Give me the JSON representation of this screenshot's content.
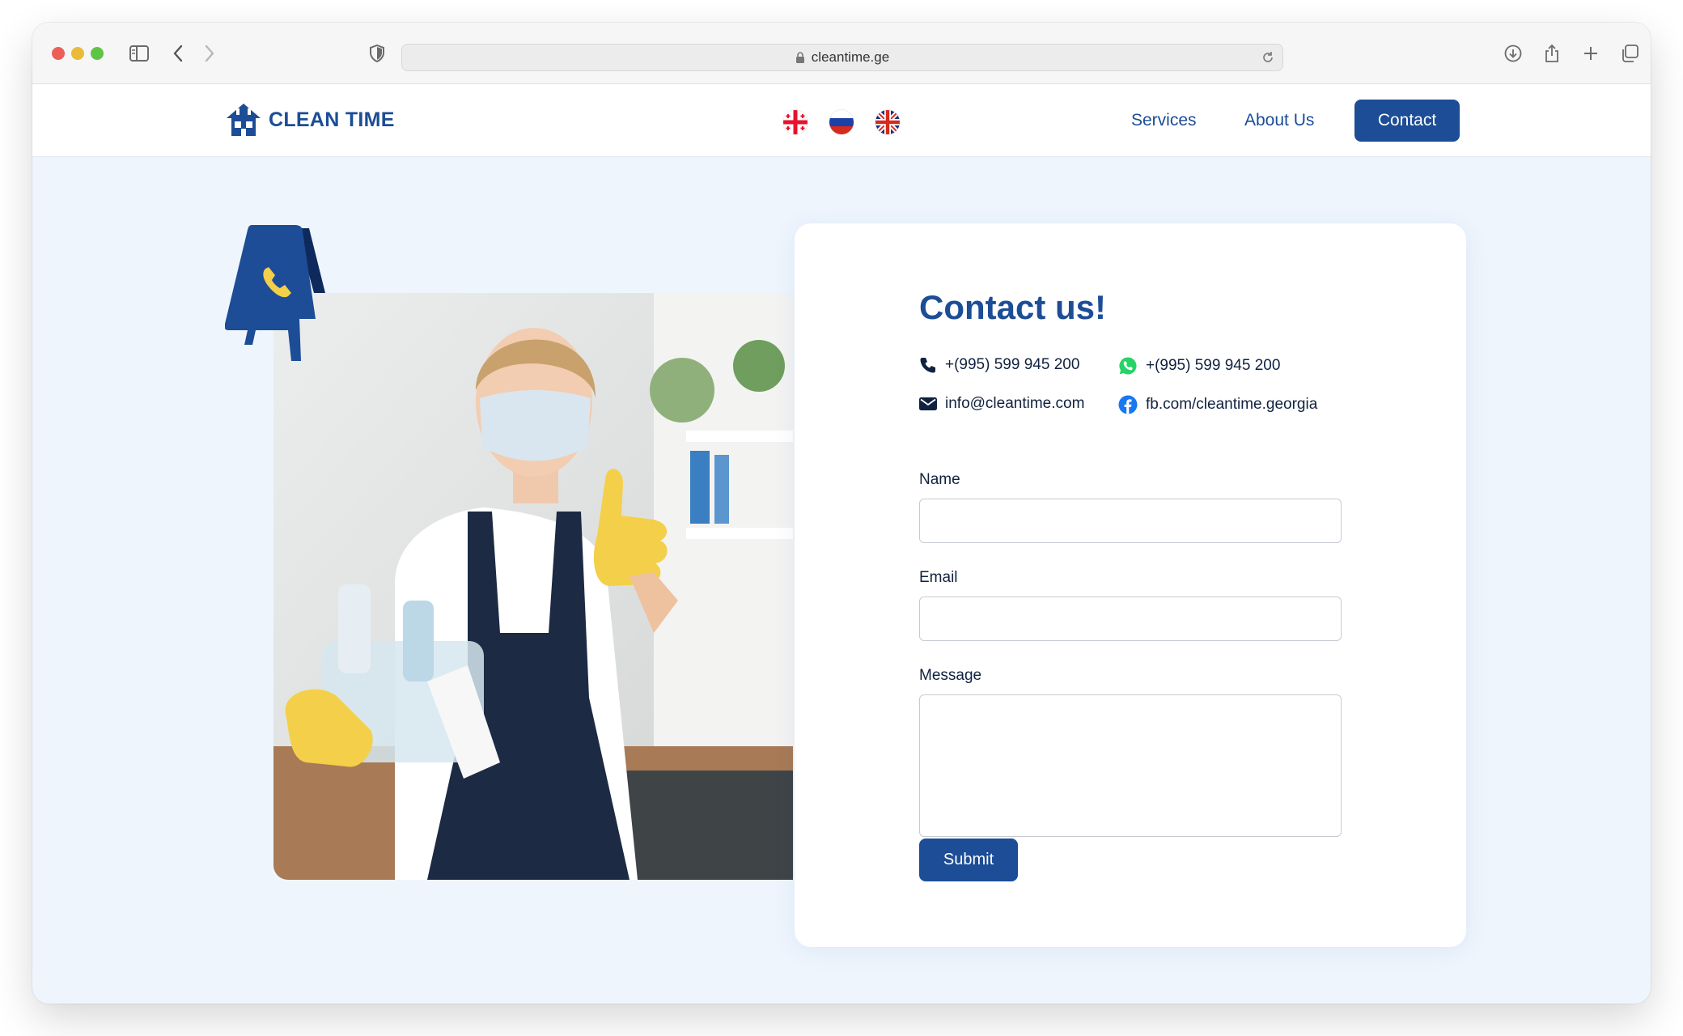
{
  "browser": {
    "url": "cleantime.ge"
  },
  "site": {
    "logo_text": "CLEAN TIME",
    "languages": [
      "Georgian",
      "Russian",
      "English"
    ],
    "nav": {
      "services": "Services",
      "about": "About Us",
      "contact": "Contact"
    }
  },
  "contact": {
    "title": "Contact us!",
    "phone": "+(995) 599 945 200",
    "whatsapp": "+(995) 599 945 200",
    "email": "info@cleantime.com",
    "facebook": "fb.com/cleantime.georgia"
  },
  "form": {
    "name_label": "Name",
    "name_value": "",
    "email_label": "Email",
    "email_value": "",
    "message_label": "Message",
    "message_value": "",
    "submit_label": "Submit"
  },
  "colors": {
    "brand_blue": "#1c4d96",
    "page_bg": "#eef5fd",
    "accent_yellow": "#f4cf4a",
    "whatsapp_green": "#25d366",
    "facebook_blue": "#1877f2"
  }
}
